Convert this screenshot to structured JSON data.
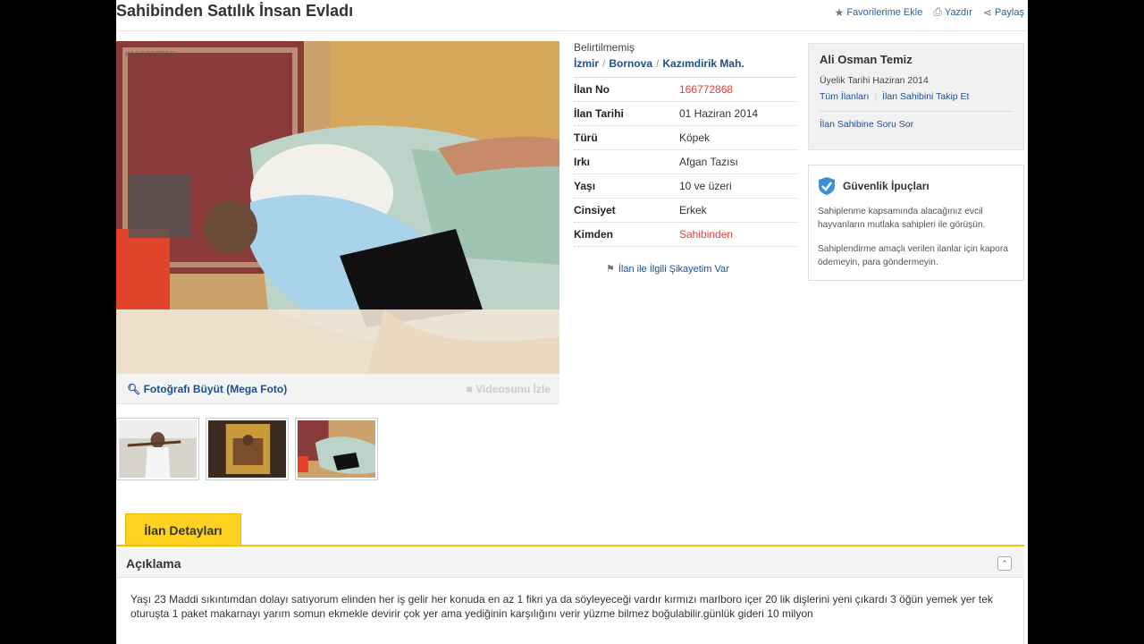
{
  "page": {
    "title": "Sahibinden Satılık İnsan Evladı"
  },
  "actions": {
    "favorite": "Favorilerime Ekle",
    "print": "Yazdır",
    "share": "Paylaş"
  },
  "photo": {
    "watermark": "#166772868",
    "zoom_label": "Fotoğrafı Büyüt (Mega Foto)",
    "video_label": "Videosunu İzle"
  },
  "location": {
    "top": "Belirtilmemiş",
    "city": "İzmir",
    "district": "Bornova",
    "neighborhood": "Kazımdirik Mah."
  },
  "details": [
    {
      "label": "İlan No",
      "value": "166772868",
      "color": "#e0403a"
    },
    {
      "label": "İlan Tarihi",
      "value": "01 Haziran 2014"
    },
    {
      "label": "Türü",
      "value": "Köpek"
    },
    {
      "label": "Irkı",
      "value": "Afgan Tazısı"
    },
    {
      "label": "Yaşı",
      "value": "10 ve üzeri"
    },
    {
      "label": "Cinsiyet",
      "value": "Erkek"
    },
    {
      "label": "Kimden",
      "value": "Sahibinden",
      "color": "#e0403a"
    }
  ],
  "complaint": "İlan ile İlgili Şikayetim Var",
  "seller": {
    "name": "Ali Osman Temiz",
    "since": "Üyelik Tarihi  Haziran 2014",
    "all_ads": "Tüm İlanları",
    "follow": "İlan Sahibini Takip Et",
    "ask": "İlan Sahibine Soru Sor"
  },
  "safety": {
    "title": "Güvenlik İpuçları",
    "tip1": "Sahiplenme kapsamında alacağınız evcil hayvanların mutlaka sahipleri ile görüşün.",
    "tip2": "Sahiplendirme amaçlı verilen ilanlar için kapora ödemeyin, para göndermeyin."
  },
  "tab": {
    "label": "İlan Detayları"
  },
  "description": {
    "title": "Açıklama",
    "text": "Yaşı 23 Maddi sıkıntımdan dolayı satıyorum elinden her iş gelir her konuda en az 1 fikri ya da söyleyeceği vardır kırmızı marlboro içer  20 lik dişlerini yeni çıkardı 3 öğün yemek yer tek oturuşta 1 paket makarnayı yarım somun ekmekle devirir çok yer ama yediğinin karşılığını verir yüzme bilmez boğulabilir.günlük gideri 10 milyon"
  },
  "colors": {
    "link": "#1d4f8f",
    "accent_red": "#e0403a",
    "tab_yellow": "#ffd21f"
  }
}
